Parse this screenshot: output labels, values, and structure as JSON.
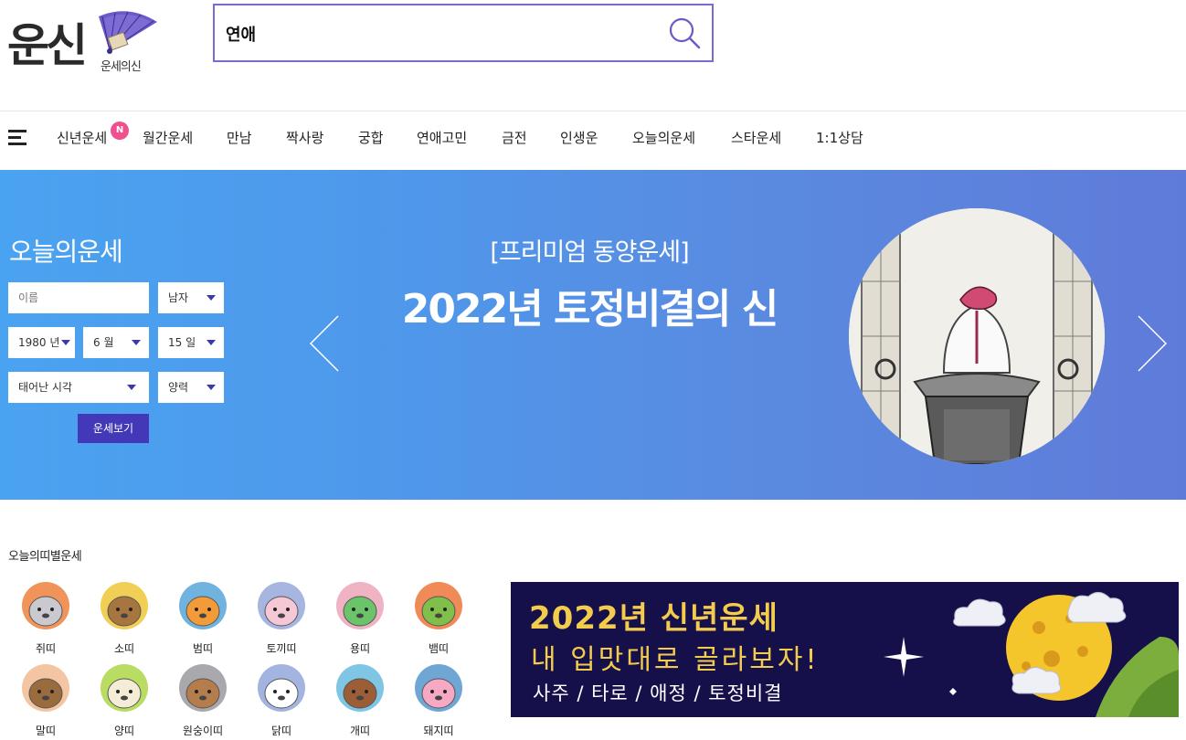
{
  "logo": {
    "main": "운신",
    "sub": "운세의신"
  },
  "search": {
    "value": "연애",
    "placeholder": ""
  },
  "nav": {
    "items": [
      "신년운세",
      "월간운세",
      "만남",
      "짝사랑",
      "궁합",
      "연애고민",
      "금전",
      "인생운",
      "오늘의운세",
      "스타운세",
      "1:1상담"
    ],
    "new_badge": "N"
  },
  "today_fortune": {
    "title": "오늘의운세",
    "name_placeholder": "이름",
    "gender": "남자",
    "year": "1980 년",
    "month": "6 월",
    "day": "15 일",
    "birth_time": "태어난 시각",
    "calendar": "양력",
    "submit_label": "운세보기"
  },
  "hero_banner": {
    "subtitle": "[프리미엄 동양운세]",
    "title": "2022년 토정비결의 신"
  },
  "zodiac": {
    "section_title": "오늘의띠별운세",
    "items": [
      {
        "label": "쥐띠",
        "bg": "#f0945a",
        "face": "#c9c9cf"
      },
      {
        "label": "소띠",
        "bg": "#f1cf55",
        "face": "#a7753f"
      },
      {
        "label": "범띠",
        "bg": "#6fb3de",
        "face": "#f39b38"
      },
      {
        "label": "토끼띠",
        "bg": "#a7b6e0",
        "face": "#f6c7d4"
      },
      {
        "label": "용띠",
        "bg": "#f0b3c4",
        "face": "#6cc46a"
      },
      {
        "label": "뱀띠",
        "bg": "#f08a57",
        "face": "#7fbf4a"
      },
      {
        "label": "말띠",
        "bg": "#f3c5a3",
        "face": "#9a6b3d"
      },
      {
        "label": "양띠",
        "bg": "#b9dc62",
        "face": "#f5ecd8"
      },
      {
        "label": "원숭이띠",
        "bg": "#a9a9ad",
        "face": "#b57d4c"
      },
      {
        "label": "닭띠",
        "bg": "#a4b4e0",
        "face": "#ffffff"
      },
      {
        "label": "개띠",
        "bg": "#7fc6e4",
        "face": "#9c5e36"
      },
      {
        "label": "돼지띠",
        "bg": "#6fa6d4",
        "face": "#f7a9c4"
      }
    ]
  },
  "promo": {
    "line1": "2022년 신년운세",
    "line2": "내 입맛대로 골라보자!",
    "line3": "사주 / 타로 / 애정 / 토정비결"
  },
  "colors": {
    "accent": "#7b6ad1",
    "button": "#4338b8",
    "badge": "#f0508e",
    "promo_bg": "#15104a",
    "promo_text": "#f3cc4e"
  }
}
